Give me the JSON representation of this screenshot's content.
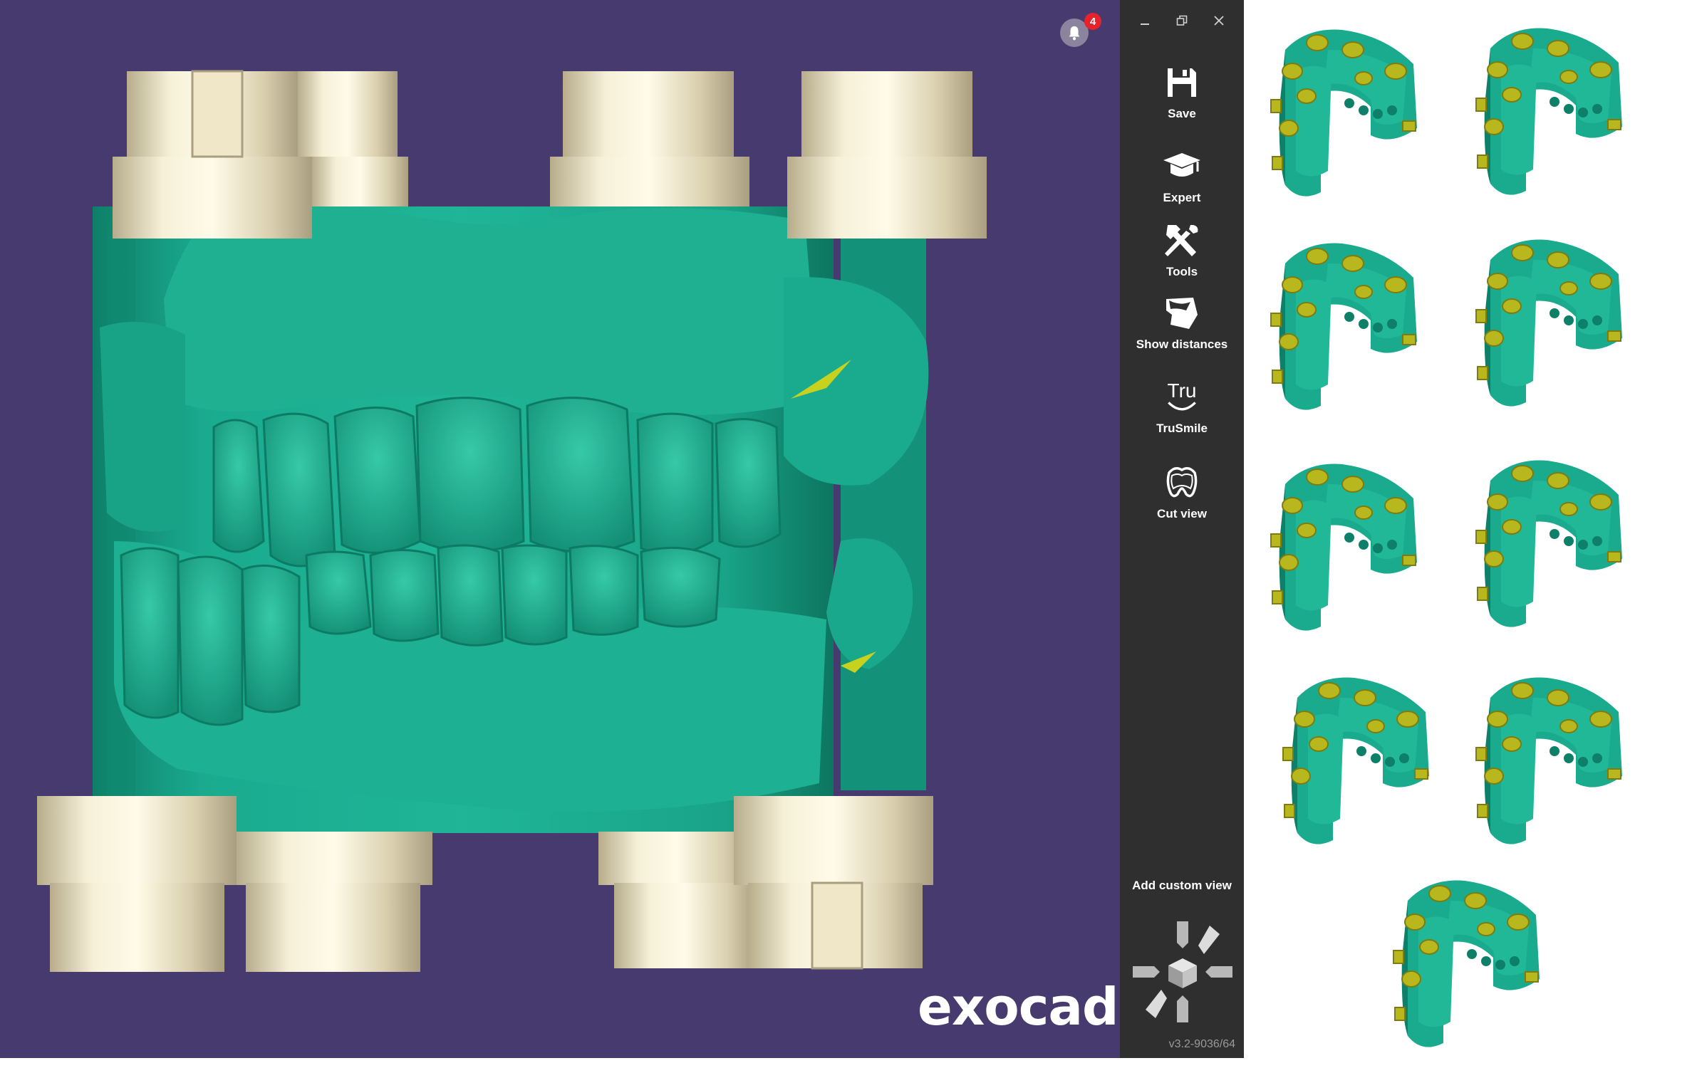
{
  "viewport": {
    "brand": "exocad",
    "notifications": {
      "count": "4"
    }
  },
  "window_controls": {
    "minimize": "–",
    "restore": "❐",
    "close": "✕"
  },
  "toolbar": {
    "tools": [
      {
        "label": "Save",
        "icon": "save-icon"
      },
      {
        "label": "Expert",
        "icon": "graduation-cap-icon"
      },
      {
        "label": "Tools",
        "icon": "hammer-wrench-icon"
      },
      {
        "label": "Show distances",
        "icon": "distance-map-icon"
      },
      {
        "label": "TruSmile",
        "icon": "trusmile-icon",
        "icon_text": "Tru"
      },
      {
        "label": "Cut view",
        "icon": "tooth-cut-icon"
      }
    ],
    "add_custom_view": "Add custom view",
    "version": "v3.2-9036/64"
  },
  "thumbnails": {
    "count": 9,
    "icon": "dental-model-thumbnail"
  },
  "colors": {
    "viewport_bg": "#463a6e",
    "model_green": "#1aab8f",
    "attachment_cream": "#e8e0c4",
    "attachment_yellow": "#b8b81e",
    "toolbar_bg": "#2f2f2f"
  }
}
